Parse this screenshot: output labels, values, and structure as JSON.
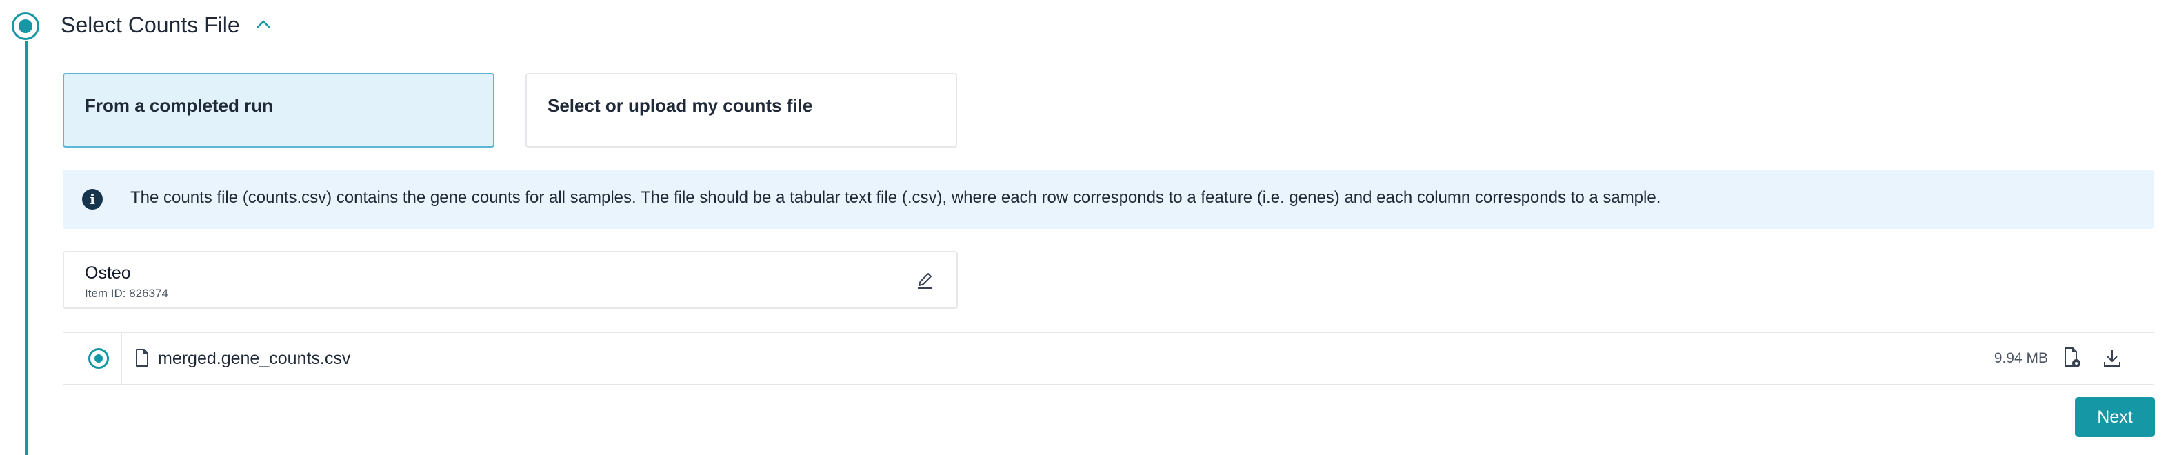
{
  "step": {
    "title": "Select Counts File"
  },
  "source_options": [
    {
      "label": "From a completed run",
      "selected": true
    },
    {
      "label": "Select or upload my counts file",
      "selected": false
    }
  ],
  "info": {
    "text": "The counts file (counts.csv) contains the gene counts for all samples. The file should be a tabular text file (.csv), where each row corresponds to a feature (i.e. genes) and each column corresponds to a sample."
  },
  "selected_item": {
    "name": "Osteo",
    "id_label": "Item ID: 826374"
  },
  "files": [
    {
      "name": "merged.gene_counts.csv",
      "size": "9.94 MB",
      "selected": true
    }
  ],
  "actions": {
    "next_label": "Next"
  },
  "colors": {
    "accent": "#1597a5",
    "selected_card_bg": "#e2f2fb",
    "selected_card_border": "#5bb7d8",
    "info_bg": "#eaf4fc",
    "info_icon": "#17344d"
  },
  "icons": {
    "step": "step-indicator-icon",
    "collapse": "chevron-up-icon",
    "info": "info-icon",
    "edit": "pencil-icon",
    "file": "file-icon",
    "file_action": "file-settings-icon",
    "download": "download-icon"
  }
}
